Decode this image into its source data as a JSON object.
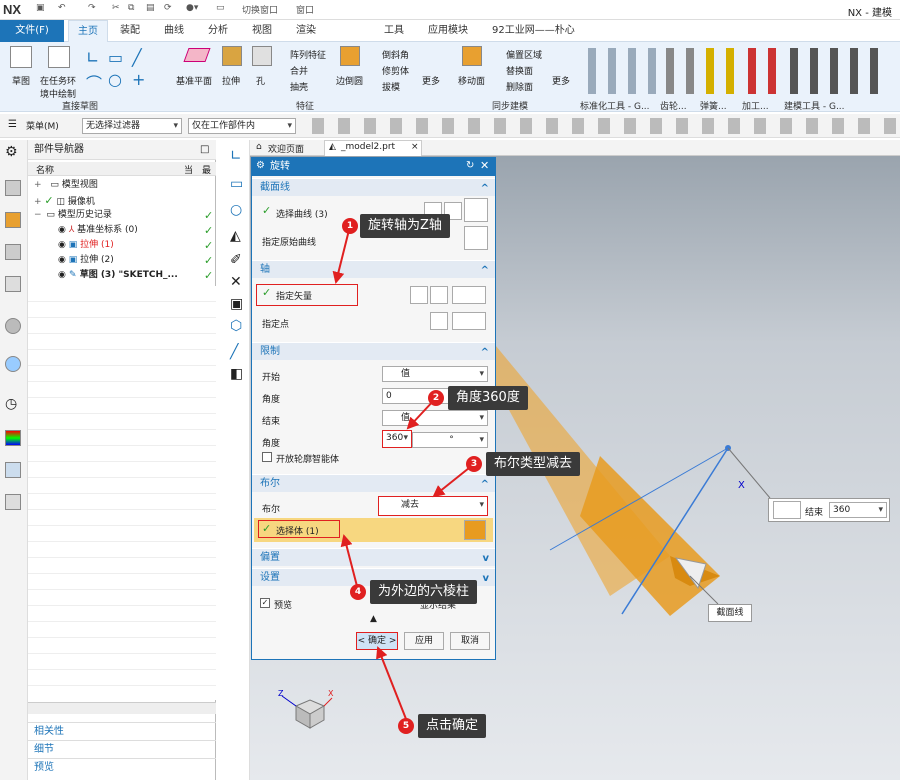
{
  "app": {
    "logo": "NX",
    "window_title": "NX - 建模",
    "switch_window": "切换窗口",
    "window_menu": "窗口"
  },
  "tabs": [
    {
      "label": "文件(F)"
    },
    {
      "label": "主页"
    },
    {
      "label": "装配"
    },
    {
      "label": "曲线"
    },
    {
      "label": "分析"
    },
    {
      "label": "视图"
    },
    {
      "label": "渲染"
    },
    {
      "label": "工具"
    },
    {
      "label": "应用模块"
    },
    {
      "label": "92工业网——朴心"
    }
  ],
  "ribbon": {
    "sketch": "草图",
    "task_env_1": "在任务环",
    "task_env_2": "境中绘制",
    "group_direct_sketch": "直接草图",
    "datum_plane": "基准平面",
    "extrude": "拉伸",
    "hole": "孔",
    "pattern_feature": "阵列特征",
    "unite": "合并",
    "shell": "抽壳",
    "edge_blend": "边倒圆",
    "chamfer": "倒斜角",
    "trim_body": "修剪体",
    "draft": "拔模",
    "more": "更多",
    "group_feature": "特征",
    "move_face": "移动面",
    "offset_region": "偏置区域",
    "replace_face": "替换面",
    "delete_face": "删除面",
    "more2": "更多",
    "group_sync": "同步建模",
    "group_std_tools": "标准化工具 - G...",
    "group_gear": "齿轮...",
    "group_spring": "弹簧...",
    "group_machining": "加工...",
    "group_modeling_tools": "建模工具 - G..."
  },
  "filterbar": {
    "menu": "菜单(M)",
    "filter": "无选择过滤器",
    "scope": "仅在工作部件内"
  },
  "navigator": {
    "title": "部件导航器",
    "col_name": "名称",
    "col_current": "当",
    "col_latest": "最",
    "items": [
      {
        "label": "模型视图"
      },
      {
        "label": "摄像机"
      },
      {
        "label": "模型历史记录"
      },
      {
        "label": "基准坐标系 (0)"
      },
      {
        "label": "拉伸 (1)"
      },
      {
        "label": "拉伸 (2)"
      },
      {
        "label": "草图 (3) \"SKETCH_..."
      }
    ],
    "footer": [
      "相关性",
      "细节",
      "预览"
    ]
  },
  "doc_tabs": {
    "welcome": "欢迎页面",
    "model": "_model2.prt"
  },
  "dialog": {
    "title": "旋转",
    "sec_section": "截面线",
    "select_curve": "选择曲线 (3)",
    "specify_origin_curve": "指定原始曲线",
    "sec_axis": "轴",
    "specify_vector": "指定矢量",
    "specify_point": "指定点",
    "sec_limits": "限制",
    "start": "开始",
    "start_value": "值",
    "angle": "角度",
    "angle_start_value": "0",
    "end": "结束",
    "end_value": "值",
    "angle_end_value": "360",
    "unit": "°",
    "open_profile": "开放轮廓智能体",
    "sec_boolean": "布尔",
    "boolean": "布尔",
    "boolean_value": "减去",
    "select_body": "选择体 (1)",
    "sec_offset": "偏置",
    "sec_settings": "设置",
    "preview": "预览",
    "show_result": "显示结果",
    "ok": "< 确定 >",
    "apply": "应用",
    "cancel": "取消"
  },
  "callouts": [
    {
      "num": "1",
      "text": "旋转轴为Z轴"
    },
    {
      "num": "2",
      "text": "角度360度"
    },
    {
      "num": "3",
      "text": "布尔类型减去"
    },
    {
      "num": "4",
      "text": "为外边的六棱柱"
    },
    {
      "num": "5",
      "text": "点击确定"
    }
  ],
  "viewport": {
    "float_end_label": "结束",
    "float_end_value": "360",
    "section_line_label": "截面线",
    "axis_x": "X",
    "axis_z": "Z"
  },
  "colors": {
    "accent": "#1d74b8",
    "callout_bg": "#3a3a3a",
    "marker_red": "#e02020",
    "body_orange": "#f0a020",
    "check_green": "#2a9d2a"
  }
}
